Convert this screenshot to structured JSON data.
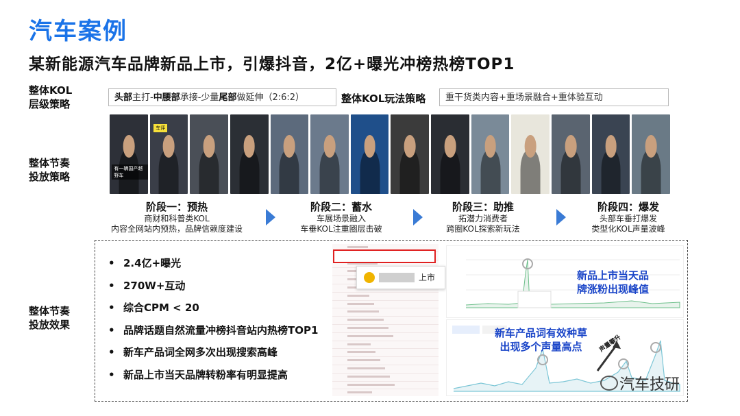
{
  "header": {
    "title": "汽车案例",
    "subtitle": "某新能源汽车品牌新品上市，引爆抖音，2亿+曝光冲榜热榜TOP1"
  },
  "strategy": {
    "kol_label_1": "整体KOL",
    "kol_label_2": "层级策略",
    "kol_box": {
      "p1": "头部",
      "p2": "主打-",
      "p3": "中腰部",
      "p4": "承接-少量",
      "p5": "尾部",
      "p6": "做延伸（2:6:2）"
    },
    "play_label": "整体KOL玩法策略",
    "play_box": "重干货类内容+重场景融合+重体验互动",
    "rhythm_label_1": "整体节奏",
    "rhythm_label_2": "投放策略"
  },
  "photo_tags": [
    "有一辆国产越野车",
    "车评",
    "",
    "",
    "",
    "",
    "",
    "",
    "",
    "",
    "",
    "",
    "",
    ""
  ],
  "stages": [
    {
      "title": "阶段一：预热",
      "line1": "商财和科普类KOL",
      "line2": "内容全网站内预热，品牌信赖度建设"
    },
    {
      "title": "阶段二：蓄水",
      "line1": "车展场景融入",
      "line2": "车垂KOL注重圈层击破"
    },
    {
      "title": "阶段三：助推",
      "line1": "拓潜力消费者",
      "line2": "跨圈KOL探索新玩法"
    },
    {
      "title": "阶段四：爆发",
      "line1": "头部车垂打爆发",
      "line2": "类型化KOL声量波峰"
    }
  ],
  "effect": {
    "label_1": "整体节奏",
    "label_2": "投放效果",
    "bullets": [
      "2.4亿+曝光",
      "270W+互动",
      "综合CPM < 20",
      "品牌话题自然流量冲榜抖音站内热榜TOP1",
      "新车产品词全网多次出现搜索高峰",
      "新品上市当天品牌转粉率有明显提高"
    ],
    "bullet_symbol": "•",
    "popup_text": "上市",
    "chart1_annotation_1": "新品上市当天品",
    "chart1_annotation_2": "牌涨粉出现峰值",
    "chart2_annotation_1": "新车产品词有效种草",
    "chart2_annotation_2": "出现多个声量高点",
    "chart2_side": "声量攀升"
  },
  "watermark": "汽车技研",
  "colors": {
    "title": "#1a73e8",
    "annotation": "#1a45c8",
    "highlight": "#e02020",
    "chevron": "#3a7bd5"
  }
}
